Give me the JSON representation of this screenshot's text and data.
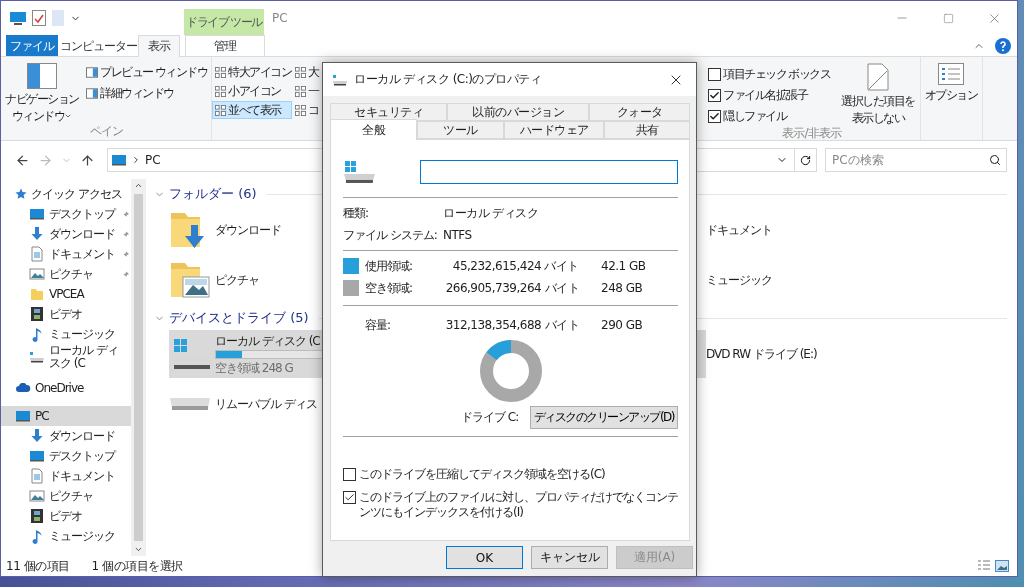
{
  "titlebar": {
    "contextual_group": "ドライブ ツール",
    "title": "PC"
  },
  "ribbon_tabs": [
    {
      "label": "ファイル",
      "kind": "file",
      "selected": false
    },
    {
      "label": "コンピューター",
      "kind": "tab",
      "selected": false
    },
    {
      "label": "表示",
      "kind": "tab",
      "selected": true
    },
    {
      "label": "管理",
      "kind": "context",
      "selected": false
    }
  ],
  "ribbon": {
    "panes": {
      "nav_pane": [
        "ナビゲーション",
        "ウィンドウ"
      ],
      "preview": "プレビュー ウィンドウ",
      "details": "詳細ウィンドウ",
      "label": "ペイン"
    },
    "layout": {
      "options": [
        {
          "label": "特大アイコン",
          "selected": false
        },
        {
          "label": "小アイコン",
          "selected": false
        },
        {
          "label": "並べて表示",
          "selected": true
        },
        {
          "label": "大",
          "selected": false
        },
        {
          "label": "一",
          "selected": false
        },
        {
          "label": "コ",
          "selected": false
        }
      ]
    },
    "show_hide": {
      "checkboxes": [
        {
          "label": "項目チェック ボックス",
          "checked": false
        },
        {
          "label": "ファイル名拡張子",
          "checked": true
        },
        {
          "label": "隠しファイル",
          "checked": true
        }
      ],
      "hide_selected": [
        "選択した項目を",
        "表示しない"
      ],
      "label": "表示/非表示"
    },
    "options": "オプション"
  },
  "address": {
    "path": "PC",
    "search_placeholder": "PCの検索"
  },
  "sidebar": {
    "groups": [
      {
        "label": "クイック アクセス",
        "kind": "star",
        "selected": false,
        "children": [
          {
            "label": "デスクトップ",
            "kind": "desktop",
            "pinned": true,
            "selected": false
          },
          {
            "label": "ダウンロード",
            "kind": "download",
            "pinned": true,
            "selected": false
          },
          {
            "label": "ドキュメント",
            "kind": "document",
            "pinned": true,
            "selected": false
          },
          {
            "label": "ピクチャ",
            "kind": "picture",
            "pinned": true,
            "selected": false
          },
          {
            "label": "VPCEA",
            "kind": "folder",
            "pinned": false,
            "selected": false
          },
          {
            "label": "ビデオ",
            "kind": "video",
            "pinned": false,
            "selected": false
          },
          {
            "label": "ミュージック",
            "kind": "music",
            "pinned": false,
            "selected": false
          },
          {
            "label": "ローカル ディスク (C",
            "kind": "drive",
            "pinned": false,
            "selected": false
          }
        ]
      },
      {
        "label": "OneDrive",
        "kind": "cloud",
        "selected": false
      },
      {
        "label": "PC",
        "kind": "pc",
        "selected": true,
        "children": [
          {
            "label": "ダウンロード",
            "kind": "download",
            "pinned": false,
            "selected": false
          },
          {
            "label": "デスクトップ",
            "kind": "desktop",
            "pinned": false,
            "selected": false
          },
          {
            "label": "ドキュメント",
            "kind": "document",
            "pinned": false,
            "selected": false
          },
          {
            "label": "ピクチャ",
            "kind": "picture",
            "pinned": false,
            "selected": false
          },
          {
            "label": "ビデオ",
            "kind": "video",
            "pinned": false,
            "selected": false
          },
          {
            "label": "ミュージック",
            "kind": "music",
            "pinned": false,
            "selected": false
          }
        ]
      }
    ]
  },
  "content": {
    "groups": [
      {
        "title": "フォルダー (6)",
        "items": [
          {
            "name": "ダウンロード",
            "kind": "downloads",
            "selected": false
          },
          {
            "name": "ドキュメント",
            "selected": false
          },
          {
            "name": "ピクチャ",
            "kind": "pictures",
            "selected": false
          },
          {
            "name": "ミュージック",
            "selected": false
          }
        ]
      },
      {
        "title": "デバイスとドライブ (5)",
        "items": [
          {
            "name": "ローカル ディスク (C",
            "kind": "system-drive",
            "selected": true,
            "level": 0.145,
            "free": "空き領域 248 G"
          },
          {
            "name": "DVD RW ドライブ (E:)",
            "selected": false
          },
          {
            "name": "リムーバブル ディス",
            "kind": "removable",
            "selected": false
          }
        ]
      }
    ]
  },
  "status_bar": [
    "11 個の項目",
    "1 個の項目を選択"
  ],
  "dialog": {
    "title": "ローカル ディスク (C:)のプロパティ",
    "tabs_back": [
      {
        "label": "セキュリティ",
        "selected": false
      },
      {
        "label": "以前のバージョン",
        "selected": false
      },
      {
        "label": "クォータ",
        "selected": false
      }
    ],
    "tabs_front": [
      {
        "label": "全般",
        "selected": true
      },
      {
        "label": "ツール",
        "selected": false
      },
      {
        "label": "ハードウェア",
        "selected": false
      },
      {
        "label": "共有",
        "selected": false
      }
    ],
    "info": [
      {
        "label": "種類:",
        "value": "ローカル ディスク"
      },
      {
        "label": "ファイル システム:",
        "value": "NTFS"
      }
    ],
    "usage": [
      {
        "label": "使用領域:",
        "bytes": "45,232,615,424 バイト",
        "size": "42.1 GB",
        "color": "#26a0da"
      },
      {
        "label": "空き領域:",
        "bytes": "266,905,739,264 バイト",
        "size": "248 GB",
        "color": "#a8a8a8"
      }
    ],
    "capacity": {
      "label": "容量:",
      "bytes": "312,138,354,688 バイト",
      "size": "290 GB",
      "level": 0.145
    },
    "drive_label": "ドライブ C:",
    "cleanup_button": "ディスクのクリーンアップ(D)",
    "options": [
      {
        "label": "このドライブを圧縮してディスク領域を空ける(C)",
        "checked": false
      },
      {
        "label": "このドライブ上のファイルに対し、プロパティだけでなくコンテンツにもインデックスを付ける(I)",
        "checked": true
      }
    ],
    "buttons": [
      {
        "label": "OK",
        "kind": "default"
      },
      {
        "label": "キャンセル",
        "kind": "normal"
      },
      {
        "label": "適用(A)",
        "kind": "disabled"
      }
    ]
  }
}
